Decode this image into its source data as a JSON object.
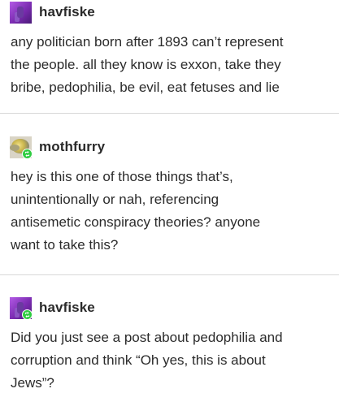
{
  "posts": [
    {
      "username": "havfiske",
      "avatar": "purple-character-avatar",
      "reblog_badge": false,
      "lines": [
        "any politician born after 1893 can’t represent",
        "the people. all they know is exxon, take they",
        "bribe, pedophilia, be evil, eat fetuses and lie"
      ]
    },
    {
      "username": "mothfurry",
      "avatar": "moth-avatar",
      "reblog_badge": true,
      "lines": [
        "hey is this one of those things that’s,",
        "unintentionally or nah, referencing",
        "antisemetic conspiracy theories? anyone",
        "want to take this?"
      ]
    },
    {
      "username": "havfiske",
      "avatar": "purple-character-avatar",
      "reblog_badge": true,
      "lines": [
        "Did you just see a post about pedophilia and",
        "corruption and think “Oh yes, this is about",
        "Jews”?"
      ]
    }
  ],
  "colors": {
    "background": "#ffffff",
    "text": "#2b2b2b",
    "divider": "#d8d8d8",
    "badge": "#2ecc40"
  }
}
